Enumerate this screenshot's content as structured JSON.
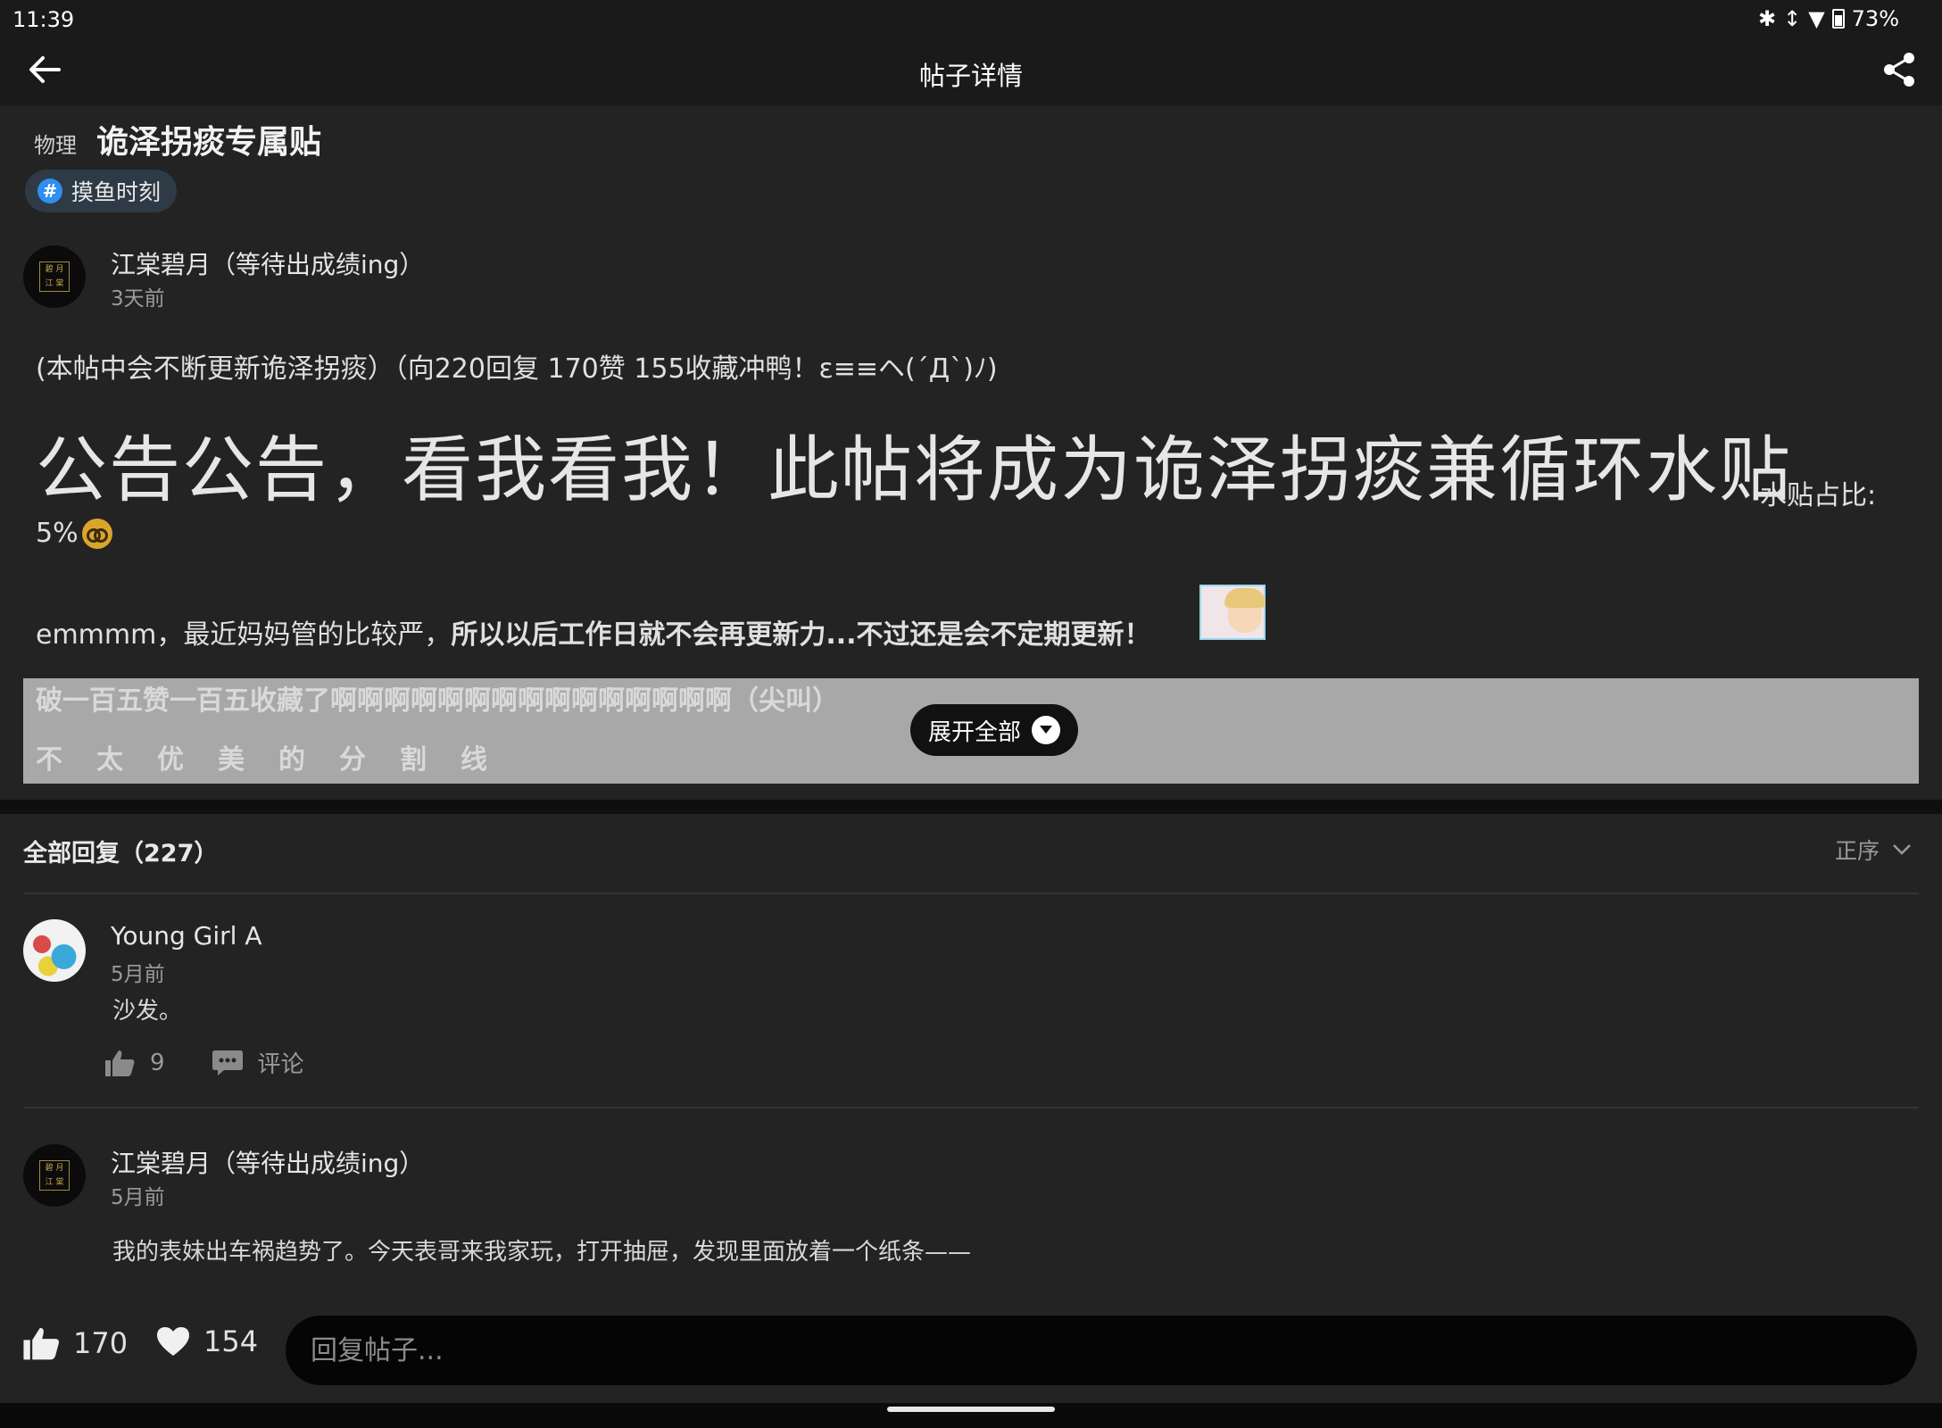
{
  "status": {
    "time": "11:39",
    "battery": "73%"
  },
  "appbar": {
    "title": "帖子详情"
  },
  "post": {
    "subject": "物理",
    "title": "诡泽拐痰专属贴",
    "topic": "摸鱼时刻",
    "author": "江棠碧月（等待出成绩ing）",
    "time": "3天前",
    "p1": "(本帖中会不断更新诡泽拐痰）（向220回复 170赞 155收藏冲鸭！ε≡≡ヘ(´Д`)ﾉ)",
    "big": "公告公告，看我看我！此帖将成为诡泽拐痰兼循环水贴",
    "small_tail": "水贴占比:",
    "pct": "5%",
    "p3_normal": "emmmm，最近妈妈管的比较严，",
    "p3_bold": "所以以后工作日就不会再更新力...不过还是会不定期更新！",
    "fold_line1": "破一百五赞一百五收藏了啊啊啊啊啊啊啊啊啊啊啊啊啊啊啊（尖叫）",
    "fold_line2": "不太优美的分割线",
    "expand": "展开全部"
  },
  "replies": {
    "header": "全部回复（227）",
    "order": "正序",
    "items": [
      {
        "author": "Young Girl A",
        "time": "5月前",
        "text": "沙发。",
        "likes": "9",
        "comment": "评论"
      },
      {
        "author": "江棠碧月（等待出成绩ing）",
        "time": "5月前",
        "text": "我的表妹出车祸趋势了。今天表哥来我家玩，打开抽屉，发现里面放着一个纸条——"
      }
    ]
  },
  "bottom": {
    "likes": "170",
    "favorites": "154",
    "reply_placeholder": "回复帖子..."
  },
  "colors": {
    "background": "#232323",
    "chip_hash": "#2f8ef0",
    "fold": "#a8a8a8"
  }
}
